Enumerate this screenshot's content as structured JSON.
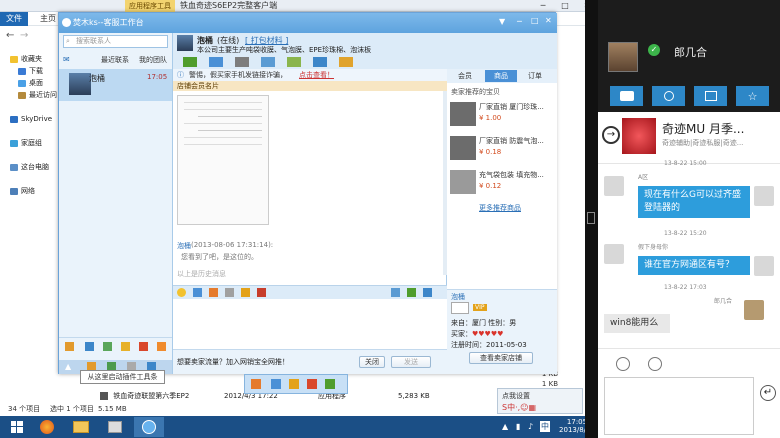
{
  "explorer": {
    "app_tools_label": "应用程序工具",
    "window_title": "铁血奇迹S6EP2完整客户端",
    "ribbon": {
      "file": "文件",
      "home": "主页"
    },
    "sidebar": [
      {
        "label": "收藏夹"
      },
      {
        "label": "下载"
      },
      {
        "label": "桌面"
      },
      {
        "label": "最近访问"
      },
      {
        "label": "SkyDrive"
      },
      {
        "label": "家庭组"
      },
      {
        "label": "这台电脑"
      },
      {
        "label": "网络"
      }
    ],
    "files": [
      {
        "size": "1 KB"
      },
      {
        "size": "1 KB"
      },
      {
        "size": "5,283 KB"
      }
    ],
    "game_file": {
      "name": "铁血奇迹联盟第六季EP2",
      "date": "2012/4/3 17:22",
      "type": "应用程序",
      "size": "5,283 KB"
    },
    "status": {
      "count": "34 个项目",
      "selected": "选中 1 个项目",
      "size": "5.15 MB"
    }
  },
  "taskbar": {
    "clock_time": "17:05",
    "clock_date": "2013/8/22",
    "ime_label": "点我设置"
  },
  "qq": {
    "title": "焚木ks--客服工作台",
    "search_placeholder": "搜索联系人",
    "left_tabs": [
      "最近联系",
      "我的团队"
    ],
    "contact": {
      "name": "泡桶",
      "time": "17:05"
    },
    "chat_header": {
      "name": "泡桶",
      "status": "(在线)",
      "link": "[ 打包材料 ]",
      "desc": "本公司主要生产吨袋收膜、气泡膜、EPE珍珠棉、泡沫板"
    },
    "notice": "警惕，假买家手机发链接诈骗，",
    "notice_link": "点击查看！",
    "card_label": "店铺会员名片",
    "message": {
      "sender": "泡桶",
      "time": "(2013-08-06 17:31:14):",
      "text": "您看到了吧，是这位的。"
    },
    "divider": "以上是历史消息",
    "chat_bottom": {
      "promo": "想要卖家流量？加入网销宝全网推！",
      "close": "关闭",
      "send": "发送"
    },
    "right_tabs": [
      "会员",
      "商品",
      "订单"
    ],
    "right_section": "卖家推荐的宝贝",
    "products": [
      {
        "name": "厂家直销 厦门珍珠...",
        "price": "¥ 1.00"
      },
      {
        "name": "厂家直销 防震气泡...",
        "price": "¥ 0.18"
      },
      {
        "name": "充气袋包装 填充物...",
        "price": "¥ 0.12"
      }
    ],
    "more_link": "更多推荐商品",
    "member": {
      "name": "泡桶",
      "badge": "VIP",
      "location_label": "来自：",
      "location": "厦门",
      "gender_label": "性别：",
      "gender": "男",
      "buyer_label": "买家：",
      "reg_label": "注册时间：",
      "reg_date": "2011-05-03",
      "shop_button": "查看卖家店铺"
    },
    "tooltip": "从这里启动插件工具条"
  },
  "right_panel": {
    "username": "郎几合",
    "banner": {
      "title": "奇迹MU 月季...",
      "subtitle": "奇迹辅助|奇迹私服|奇迹..."
    },
    "messages": [
      {
        "side": "right",
        "sender": "",
        "time": "13-8-22 15:00",
        "text": ""
      },
      {
        "side": "left",
        "sender": "A区",
        "time": "",
        "text": ""
      },
      {
        "side": "right",
        "sender": "",
        "time": "",
        "text": "现在有什么G可以过齐盛登陆器的"
      },
      {
        "side": "left",
        "sender": "",
        "time": "13-8-22 15:20",
        "text": ""
      },
      {
        "side": "left",
        "sender": "假下身母你",
        "time": "",
        "text": ""
      },
      {
        "side": "right",
        "sender": "",
        "time": "",
        "text": "谁在官方网通区有号？"
      },
      {
        "side": "left",
        "sender": "",
        "time": "13-8-22 17:03",
        "text": ""
      },
      {
        "side": "right",
        "sender": "郎几合",
        "time": "",
        "text": "win8能用么"
      }
    ]
  },
  "colors": {
    "qq_blue": "#5ea3de",
    "taskbar": "#1b4f86",
    "bubble": "#2d9ddc",
    "price": "#d24b1e"
  }
}
